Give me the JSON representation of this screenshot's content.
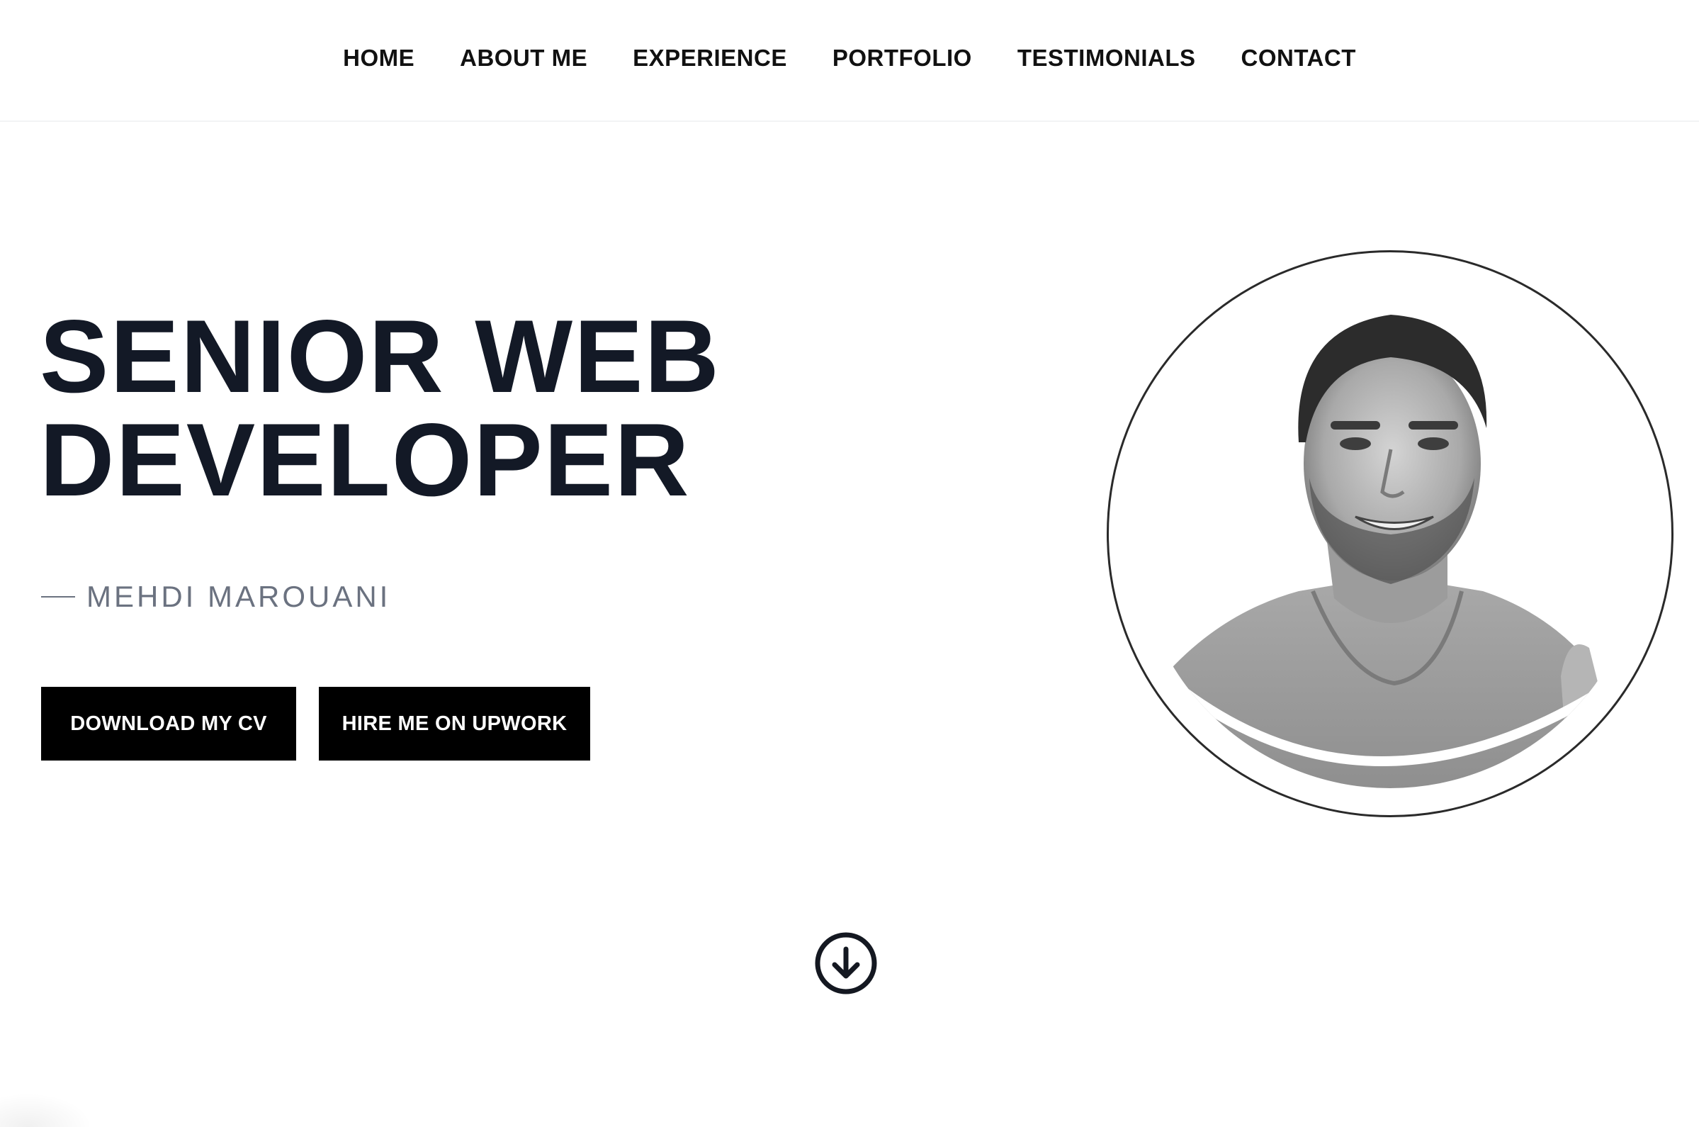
{
  "nav": {
    "items": [
      {
        "label": "HOME"
      },
      {
        "label": "ABOUT ME"
      },
      {
        "label": "EXPERIENCE"
      },
      {
        "label": "PORTFOLIO"
      },
      {
        "label": "TESTIMONIALS"
      },
      {
        "label": "CONTACT"
      }
    ]
  },
  "hero": {
    "headline_line1": "SENIOR WEB",
    "headline_line2": "DEVELOPER",
    "name": "MEHDI MAROUANI",
    "buttons": {
      "download_cv": "DOWNLOAD MY CV",
      "hire_upwork": "HIRE ME ON UPWORK"
    },
    "portrait_icon": "person-photo",
    "scroll_icon": "arrow-down-circle-icon"
  },
  "colors": {
    "headline": "#131926",
    "byline": "#6b7280",
    "button_bg": "#000000",
    "button_text": "#ffffff",
    "nav_text": "#111111"
  }
}
